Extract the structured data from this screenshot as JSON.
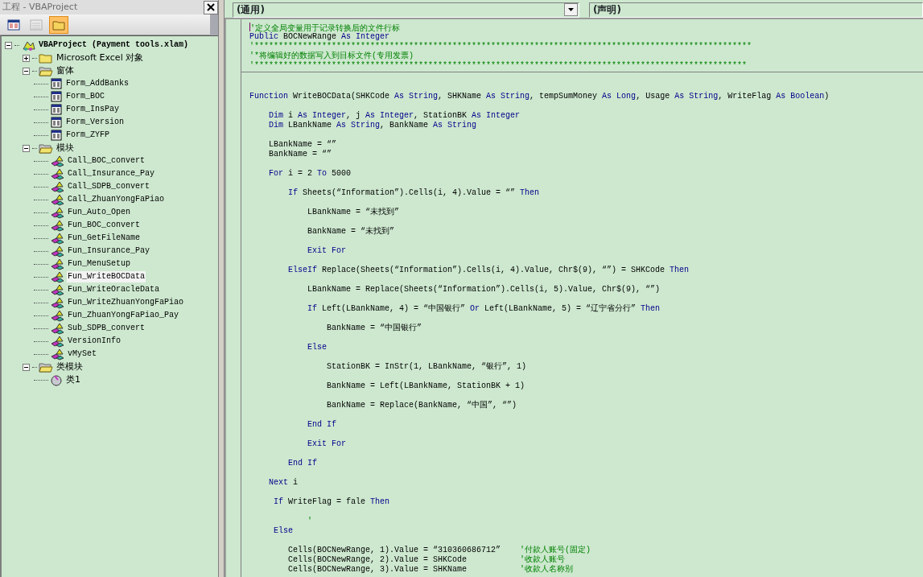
{
  "project_window": {
    "title": "工程 - VBAProject",
    "toolbar": [
      {
        "kind": "view_code",
        "pressed": false,
        "disabled": false
      },
      {
        "kind": "view_object",
        "pressed": false,
        "disabled": true
      },
      {
        "kind": "toggle_folders",
        "pressed": true,
        "disabled": false
      }
    ],
    "tree": [
      {
        "kind": "project",
        "label": "VBAProject (Payment tools.xlam)",
        "expanded": true,
        "selected": false,
        "children": [
          {
            "kind": "folder",
            "label": "Microsoft Excel 对象",
            "expanded": false,
            "selected": false
          },
          {
            "kind": "folder",
            "label": "窗体",
            "expanded": true,
            "selected": false,
            "children": [
              {
                "kind": "form",
                "label": "Form_AddBanks",
                "selected": false
              },
              {
                "kind": "form",
                "label": "Form_BOC",
                "selected": false
              },
              {
                "kind": "form",
                "label": "Form_InsPay",
                "selected": false
              },
              {
                "kind": "form",
                "label": "Form_Version",
                "selected": false
              },
              {
                "kind": "form",
                "label": "Form_ZYFP",
                "selected": false
              }
            ]
          },
          {
            "kind": "folder",
            "label": "模块",
            "expanded": true,
            "selected": false,
            "children": [
              {
                "kind": "module",
                "label": "Call_BOC_convert",
                "selected": false
              },
              {
                "kind": "module",
                "label": "Call_Insurance_Pay",
                "selected": false
              },
              {
                "kind": "module",
                "label": "Call_SDPB_convert",
                "selected": false
              },
              {
                "kind": "module",
                "label": "Call_ZhuanYongFaPiao",
                "selected": false
              },
              {
                "kind": "module",
                "label": "Fun_Auto_Open",
                "selected": false
              },
              {
                "kind": "module",
                "label": "Fun_BOC_convert",
                "selected": false
              },
              {
                "kind": "module",
                "label": "Fun_GetFileName",
                "selected": false
              },
              {
                "kind": "module",
                "label": "Fun_Insurance_Pay",
                "selected": false
              },
              {
                "kind": "module",
                "label": "Fun_MenuSetup",
                "selected": false
              },
              {
                "kind": "module",
                "label": "Fun_WriteBOCData",
                "selected": true
              },
              {
                "kind": "module",
                "label": "Fun_WriteOracleData",
                "selected": false
              },
              {
                "kind": "module",
                "label": "Fun_WriteZhuanYongFaPiao",
                "selected": false
              },
              {
                "kind": "module",
                "label": "Fun_ZhuanYongFaPiao_Pay",
                "selected": false
              },
              {
                "kind": "module",
                "label": "Sub_SDPB_convert",
                "selected": false
              },
              {
                "kind": "module",
                "label": "VersionInfo",
                "selected": false
              },
              {
                "kind": "module",
                "label": "vMySet",
                "selected": false
              }
            ]
          },
          {
            "kind": "folder",
            "label": "类模块",
            "expanded": true,
            "selected": false,
            "children": [
              {
                "kind": "class",
                "label": "类1",
                "selected": false
              }
            ]
          }
        ]
      }
    ]
  },
  "code_window": {
    "object_box": {
      "value": "(通用)"
    },
    "procedure_box": {
      "value": "(声明)"
    },
    "lines": [
      {
        "kind": "code",
        "caret": true,
        "tokens": [
          {
            "kind": "comment",
            "text": "'定义全局变量用于记录转换后的文件行标"
          }
        ]
      },
      {
        "kind": "code",
        "tokens": [
          {
            "kind": "keyword",
            "text": "Public"
          },
          {
            "kind": "text",
            "text": " BOCNewRange "
          },
          {
            "kind": "keyword",
            "text": "As Integer"
          }
        ]
      },
      {
        "kind": "code",
        "tokens": [
          {
            "kind": "comment",
            "text": "'*******************************************************************************************************"
          }
        ]
      },
      {
        "kind": "code",
        "tokens": [
          {
            "kind": "comment",
            "text": "'*将编辑好的数据写入到目标文件(专用发票)"
          }
        ]
      },
      {
        "kind": "code",
        "tokens": [
          {
            "kind": "comment",
            "text": "'******************************************************************************************************"
          }
        ]
      },
      {
        "kind": "separator"
      },
      {
        "kind": "blank"
      },
      {
        "kind": "blank"
      },
      {
        "kind": "code",
        "tokens": [
          {
            "kind": "keyword",
            "text": "Function"
          },
          {
            "kind": "text",
            "text": " WriteBOCData(SHKCode "
          },
          {
            "kind": "keyword",
            "text": "As String"
          },
          {
            "kind": "text",
            "text": ", SHKName "
          },
          {
            "kind": "keyword",
            "text": "As String"
          },
          {
            "kind": "text",
            "text": ", tempSumMoney "
          },
          {
            "kind": "keyword",
            "text": "As Long"
          },
          {
            "kind": "text",
            "text": ", Usage "
          },
          {
            "kind": "keyword",
            "text": "As String"
          },
          {
            "kind": "text",
            "text": ", WriteFlag "
          },
          {
            "kind": "keyword",
            "text": "As Boolean"
          },
          {
            "kind": "text",
            "text": ")"
          }
        ]
      },
      {
        "kind": "blank"
      },
      {
        "kind": "code",
        "tokens": [
          {
            "kind": "keyword",
            "text": "    Dim"
          },
          {
            "kind": "text",
            "text": " i "
          },
          {
            "kind": "keyword",
            "text": "As Integer"
          },
          {
            "kind": "text",
            "text": ", j "
          },
          {
            "kind": "keyword",
            "text": "As Integer"
          },
          {
            "kind": "text",
            "text": ", StationBK "
          },
          {
            "kind": "keyword",
            "text": "As Integer"
          }
        ]
      },
      {
        "kind": "code",
        "tokens": [
          {
            "kind": "keyword",
            "text": "    Dim"
          },
          {
            "kind": "text",
            "text": " LBankName "
          },
          {
            "kind": "keyword",
            "text": "As String"
          },
          {
            "kind": "text",
            "text": ", BankName "
          },
          {
            "kind": "keyword",
            "text": "As String"
          }
        ]
      },
      {
        "kind": "blank"
      },
      {
        "kind": "code",
        "tokens": [
          {
            "kind": "text",
            "text": "    LBankName = “”"
          }
        ]
      },
      {
        "kind": "code",
        "tokens": [
          {
            "kind": "text",
            "text": "    BankName = “”"
          }
        ]
      },
      {
        "kind": "blank"
      },
      {
        "kind": "code",
        "tokens": [
          {
            "kind": "keyword",
            "text": "    For"
          },
          {
            "kind": "text",
            "text": " i = 2 "
          },
          {
            "kind": "keyword",
            "text": "To"
          },
          {
            "kind": "text",
            "text": " 5000"
          }
        ]
      },
      {
        "kind": "blank"
      },
      {
        "kind": "code",
        "tokens": [
          {
            "kind": "keyword",
            "text": "        If"
          },
          {
            "kind": "text",
            "text": " Sheets(“Information”).Cells(i, 4).Value = “” "
          },
          {
            "kind": "keyword",
            "text": "Then"
          }
        ]
      },
      {
        "kind": "blank"
      },
      {
        "kind": "code",
        "tokens": [
          {
            "kind": "text",
            "text": "            LBankName = “未找到”"
          }
        ]
      },
      {
        "kind": "blank"
      },
      {
        "kind": "code",
        "tokens": [
          {
            "kind": "text",
            "text": "            BankName = “未找到”"
          }
        ]
      },
      {
        "kind": "blank"
      },
      {
        "kind": "code",
        "tokens": [
          {
            "kind": "keyword",
            "text": "            Exit For"
          }
        ]
      },
      {
        "kind": "blank"
      },
      {
        "kind": "code",
        "tokens": [
          {
            "kind": "keyword",
            "text": "        ElseIf"
          },
          {
            "kind": "text",
            "text": " Replace(Sheets(“Information”).Cells(i, 4).Value, Chr$(9), “”) = SHKCode "
          },
          {
            "kind": "keyword",
            "text": "Then"
          }
        ]
      },
      {
        "kind": "blank"
      },
      {
        "kind": "code",
        "tokens": [
          {
            "kind": "text",
            "text": "            LBankName = Replace(Sheets(“Information”).Cells(i, 5).Value, Chr$(9), “”)"
          }
        ]
      },
      {
        "kind": "blank"
      },
      {
        "kind": "code",
        "tokens": [
          {
            "kind": "keyword",
            "text": "            If"
          },
          {
            "kind": "text",
            "text": " Left(LBankName, 4) = “中国银行” "
          },
          {
            "kind": "keyword",
            "text": "Or"
          },
          {
            "kind": "text",
            "text": " Left(LBankName, 5) = “辽宁省分行” "
          },
          {
            "kind": "keyword",
            "text": "Then"
          }
        ]
      },
      {
        "kind": "blank"
      },
      {
        "kind": "code",
        "tokens": [
          {
            "kind": "text",
            "text": "                BankName = “中国银行”"
          }
        ]
      },
      {
        "kind": "blank"
      },
      {
        "kind": "code",
        "tokens": [
          {
            "kind": "keyword",
            "text": "            Else"
          }
        ]
      },
      {
        "kind": "blank"
      },
      {
        "kind": "code",
        "tokens": [
          {
            "kind": "text",
            "text": "                StationBK = InStr(1, LBankName, “银行”, 1)"
          }
        ]
      },
      {
        "kind": "blank"
      },
      {
        "kind": "code",
        "tokens": [
          {
            "kind": "text",
            "text": "                BankName = Left(LBankName, StationBK + 1)"
          }
        ]
      },
      {
        "kind": "blank"
      },
      {
        "kind": "code",
        "tokens": [
          {
            "kind": "text",
            "text": "                BankName = Replace(BankName, “中国”, “”)"
          }
        ]
      },
      {
        "kind": "blank"
      },
      {
        "kind": "code",
        "tokens": [
          {
            "kind": "keyword",
            "text": "            End If"
          }
        ]
      },
      {
        "kind": "blank"
      },
      {
        "kind": "code",
        "tokens": [
          {
            "kind": "keyword",
            "text": "            Exit For"
          }
        ]
      },
      {
        "kind": "blank"
      },
      {
        "kind": "code",
        "tokens": [
          {
            "kind": "keyword",
            "text": "        End If"
          }
        ]
      },
      {
        "kind": "blank"
      },
      {
        "kind": "code",
        "tokens": [
          {
            "kind": "keyword",
            "text": "    Next"
          },
          {
            "kind": "text",
            "text": " i"
          }
        ]
      },
      {
        "kind": "blank"
      },
      {
        "kind": "code",
        "tokens": [
          {
            "kind": "keyword",
            "text": "     If"
          },
          {
            "kind": "text",
            "text": " WriteFlag = fale "
          },
          {
            "kind": "keyword",
            "text": "Then"
          }
        ]
      },
      {
        "kind": "blank"
      },
      {
        "kind": "code",
        "tokens": [
          {
            "kind": "comment",
            "text": "            '"
          }
        ]
      },
      {
        "kind": "code",
        "tokens": [
          {
            "kind": "keyword",
            "text": "     Else"
          }
        ]
      },
      {
        "kind": "blank"
      },
      {
        "kind": "code",
        "tokens": [
          {
            "kind": "text",
            "text": "        Cells(BOCNewRange, 1).Value = “310360686712”    "
          },
          {
            "kind": "comment",
            "text": "'付款人账号(固定)"
          }
        ]
      },
      {
        "kind": "code",
        "tokens": [
          {
            "kind": "text",
            "text": "        Cells(BOCNewRange, 2).Value = SHKCode           "
          },
          {
            "kind": "comment",
            "text": "'收款人账号"
          }
        ]
      },
      {
        "kind": "code",
        "tokens": [
          {
            "kind": "text",
            "text": "        Cells(BOCNewRange, 3).Value = SHKName           "
          },
          {
            "kind": "comment",
            "text": "'收款人名称别"
          }
        ]
      }
    ]
  }
}
